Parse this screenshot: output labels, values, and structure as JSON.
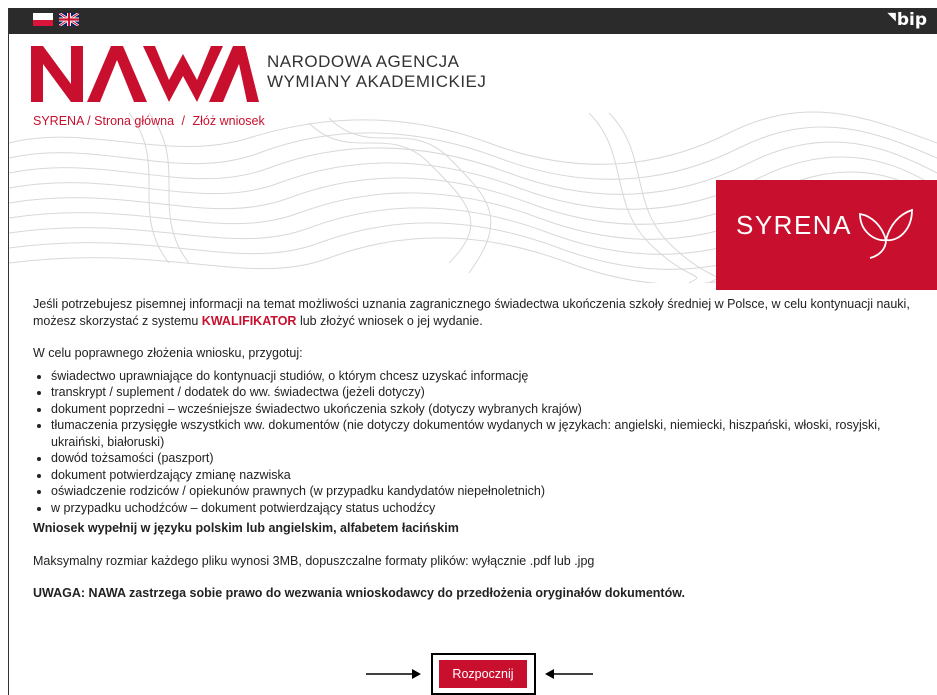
{
  "header": {
    "bip_label": "bip",
    "flags": [
      "flag-pl-icon",
      "flag-uk-icon"
    ]
  },
  "logo": {
    "brand": "NAWA",
    "agency_line1": "NARODOWA  AGENCJA",
    "agency_line2": "WYMIANY  AKADEMICKIEJ"
  },
  "breadcrumb": {
    "item1": "SYRENA / Strona główna",
    "sep": "/",
    "item2": "Złóż wniosek"
  },
  "banner": {
    "syrena": "SYRENA"
  },
  "content": {
    "intro_before": "Jeśli potrzebujesz pisemnej informacji na temat możliwości uznania zagranicznego świadectwa ukończenia szkoły średniej w Polsce, w celu kontynuacji nauki, możesz skorzystać z systemu ",
    "intro_keyword": "KWALIFIKATOR",
    "intro_after": " lub złożyć wniosek o jej wydanie.",
    "prepare_heading": "W celu poprawnego złożenia wniosku, przygotuj:",
    "items": [
      "świadectwo uprawniające do kontynuacji studiów, o którym chcesz uzyskać informację",
      "transkrypt / suplement / dodatek do ww. świadectwa (jeżeli dotyczy)",
      "dokument poprzedni – wcześniejsze świadectwo ukończenia szkoły (dotyczy wybranych krajów)",
      "tłumaczenia przysięgłe wszystkich ww. dokumentów (nie dotyczy dokumentów wydanych w językach: angielski, niemiecki, hiszpański, włoski, rosyjski, ukraiński, białoruski)",
      "dowód tożsamości (paszport)",
      "dokument potwierdzający zmianę nazwiska",
      "oświadczenie rodziców / opiekunów prawnych (w przypadku kandydatów niepełnoletnich)",
      "w przypadku uchodźców – dokument potwierdzający status uchodźcy"
    ],
    "language_note": "Wniosek wypełnij w języku polskim lub angielskim, alfabetem łacińskim",
    "size_note": "Maksymalny rozmiar każdego pliku wynosi 3MB, dopuszczalne formaty plików: wyłącznie .pdf lub .jpg",
    "warning": "UWAGA: NAWA zastrzega sobie prawo do wezwania wnioskodawcy do przedłożenia oryginałów dokumentów."
  },
  "actions": {
    "start_label": "Rozpocznij"
  },
  "colors": {
    "brand_red": "#c8102e",
    "topbar": "#2b2b2b"
  }
}
